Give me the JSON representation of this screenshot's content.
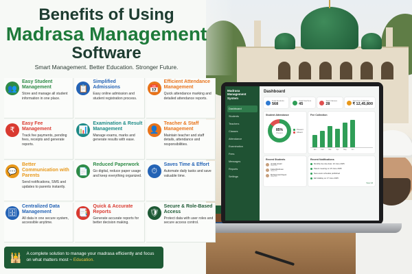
{
  "headline": {
    "line1": "Benefits of Using",
    "line2": "Madrasa Management",
    "line3": "Software",
    "tagline": "Smart Management. Better Education. Stronger Future."
  },
  "colors": {
    "dark_green": "#1e5a35",
    "accent_green": "#1e7a3a",
    "blue": "#2463b5",
    "orange": "#e8731a",
    "red": "#d93a30",
    "highlight_yellow": "#f4c542"
  },
  "features": [
    {
      "title": "Easy Student Management",
      "desc": "Store and manage all student information in one place.",
      "icon": "students-icon",
      "glyph": "👥",
      "color": "#2e8b47"
    },
    {
      "title": "Simplified Admissions",
      "desc": "Easy online admission and student registration process.",
      "icon": "admission-form-icon",
      "glyph": "📋",
      "color": "#2463b5"
    },
    {
      "title": "Efficient Attendance Management",
      "desc": "Quick attendance marking and detailed attendance reports.",
      "icon": "calendar-check-icon",
      "glyph": "📅",
      "color": "#e8731a"
    },
    {
      "title": "Easy Fee Management",
      "desc": "Track fee payments, pending fees, receipts and generate reports.",
      "icon": "rupee-icon",
      "glyph": "₹",
      "color": "#d93a30"
    },
    {
      "title": "Examination & Result Management",
      "desc": "Manage exams, marks and generate results with ease.",
      "icon": "bar-chart-icon",
      "glyph": "📊",
      "color": "#1c8a86"
    },
    {
      "title": "Teacher & Staff Management",
      "desc": "Maintain teacher and staff details, attendance and responsibilities.",
      "icon": "teacher-icon",
      "glyph": "👤",
      "color": "#e8731a"
    },
    {
      "title": "Better Communication with Parents",
      "desc": "Send notifications, SMS and updates to parents instantly.",
      "icon": "chat-icon",
      "glyph": "💬",
      "color": "#e8981a"
    },
    {
      "title": "Reduced Paperwork",
      "desc": "Go digital, reduce paper usage and keep everything organized.",
      "icon": "document-icon",
      "glyph": "📄",
      "color": "#2e8b47"
    },
    {
      "title": "Saves Time & Effort",
      "desc": "Automate daily tasks and save valuable time.",
      "icon": "clock-icon",
      "glyph": "⏱",
      "color": "#2463b5"
    },
    {
      "title": "Centralized Data Management",
      "desc": "All data in one secure system, accessible anytime.",
      "icon": "database-icon",
      "glyph": "🗄",
      "color": "#2463b5"
    },
    {
      "title": "Quick & Accurate Reports",
      "desc": "Generate accurate reports for better decision making.",
      "icon": "report-icon",
      "glyph": "📑",
      "color": "#d93a30"
    },
    {
      "title": "Secure & Role-Based Access",
      "desc": "Protect data with user roles and secure access control.",
      "icon": "shield-lock-icon",
      "glyph": "🛡",
      "color": "#1e5a35"
    }
  ],
  "banner": {
    "icon": "mosque-icon",
    "text": "A complete solution to manage your madrasa efficiently and focus on what matters most ~",
    "highlight": "Education."
  },
  "dashboard": {
    "brand": "Madrasa Management System",
    "nav": [
      "Dashboard",
      "Students",
      "Teachers",
      "Classes",
      "Attendance",
      "Examination",
      "Fees",
      "Messages",
      "Reports",
      "Settings"
    ],
    "title": "Dashboard",
    "stats": [
      {
        "label": "Total Students",
        "value": "568",
        "color": "#2f7ad1"
      },
      {
        "label": "Total Teachers",
        "value": "45",
        "color": "#2f9e57"
      },
      {
        "label": "Total Classes",
        "value": "28",
        "color": "#e05050"
      },
      {
        "label": "Total Fee Collection",
        "value": "₹ 12,45,800",
        "color": "#e8981a"
      }
    ],
    "attendance": {
      "title": "Student Attendance",
      "percent_label": "85%",
      "percent": 85,
      "sub": "Present",
      "legend": [
        {
          "label": "Present",
          "color": "#2f9e57"
        },
        {
          "label": "Absent",
          "color": "#e05050"
        }
      ]
    },
    "fee_chart": {
      "title": "Fee Collection",
      "type": "bar",
      "categories": [
        "Jan",
        "Feb",
        "Mar",
        "Apr",
        "May",
        "Jun"
      ],
      "values": [
        40,
        55,
        70,
        60,
        80,
        90
      ]
    },
    "recent_students": {
      "title": "Recent Students",
      "items": [
        {
          "name": "Junaid Ansari",
          "sub": "Class 8th"
        },
        {
          "name": "Faisal Rahman",
          "sub": "Class 7th"
        },
        {
          "name": "Muhammad Zayan",
          "sub": "Class 6th"
        }
      ]
    },
    "notifications": {
      "title": "Recent Notifications",
      "items": [
        "Monthly fee due date: 10 June 2025",
        "Parent meeting on 15 June 2025",
        "New exam schedule published",
        "Eid Holiday on 17 June 2025"
      ],
      "view_all": "View All"
    }
  }
}
